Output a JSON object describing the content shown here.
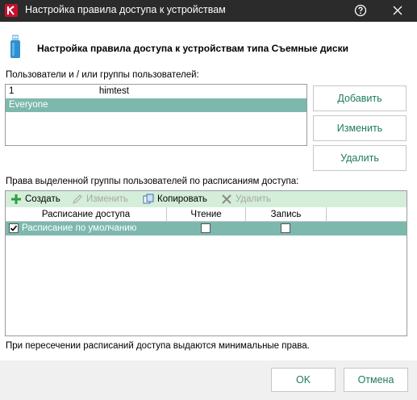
{
  "window": {
    "title": "Настройка правила доступа к устройствам",
    "help_icon": "question-circle-icon",
    "close_icon": "close-icon",
    "logo_icon": "kaspersky-logo-icon"
  },
  "header": {
    "icon": "usb-drive-icon",
    "text": "Настройка правила доступа к устройствам типа Съемные диски"
  },
  "users": {
    "label": "Пользователи и / или группы пользователей:",
    "items": [
      {
        "text": "1                                 himtest",
        "selected": false
      },
      {
        "text": "Everyone",
        "selected": true
      }
    ],
    "buttons": {
      "add": "Добавить",
      "edit": "Изменить",
      "delete": "Удалить"
    }
  },
  "rights": {
    "label": "Права выделенной группы пользователей по расписаниям доступа:",
    "toolbar": {
      "create": "Создать",
      "edit": "Изменить",
      "copy": "Копировать",
      "delete": "Удалить"
    },
    "columns": [
      "Расписание доступа",
      "Чтение",
      "Запись"
    ],
    "rows": [
      {
        "name": "Расписание по умолчанию",
        "enabled": true,
        "read": false,
        "write": false
      }
    ]
  },
  "note": "При пересечении расписаний доступа выдаются минимальные права.",
  "footer": {
    "ok": "OK",
    "cancel": "Отмена"
  },
  "colors": {
    "titlebar": "#2b2b2b",
    "accent_text": "#1f7a5c",
    "selection": "#7db8ad",
    "toolbar_bg": "#d4eeda",
    "footer_bg": "#f0f0f0"
  }
}
